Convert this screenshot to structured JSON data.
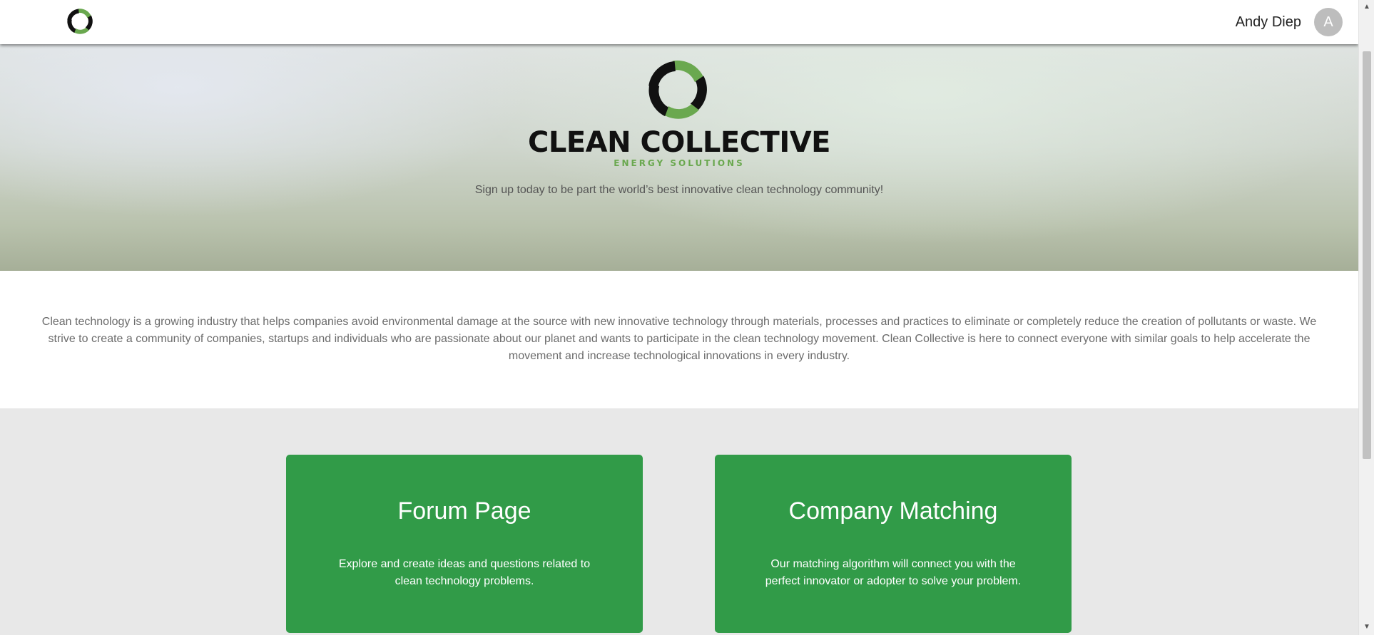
{
  "navbar": {
    "logo_icon": "clean-collective-swirl-icon",
    "user_name": "Andy Diep",
    "avatar_initial": "A"
  },
  "hero": {
    "logo_icon": "clean-collective-swirl-icon",
    "brand_name": "CLEAN COLLECTIVE",
    "brand_subtitle": "ENERGY SOLUTIONS",
    "tagline": "Sign up today to be part the world’s best innovative clean technology community!"
  },
  "about": {
    "text": "Clean technology is a growing industry that helps companies avoid environmental damage at the source with new innovative technology through materials, processes and practices to eliminate or completely reduce the creation of pollutants or waste. We strive to create a community of companies, startups and individuals who are passionate about our planet and wants to participate in the clean technology movement. Clean Collective is here to connect everyone with similar goals to help accelerate the movement and increase technological innovations in every industry."
  },
  "cards": [
    {
      "title": "Forum Page",
      "description": "Explore and create ideas and questions related to clean technology problems."
    },
    {
      "title": "Company Matching",
      "description": "Our matching algorithm will connect you with the perfect innovator or adopter to solve your problem."
    }
  ],
  "colors": {
    "brand_green": "#6aa84f",
    "card_green": "#319b48",
    "dark_logo": "#111111"
  }
}
